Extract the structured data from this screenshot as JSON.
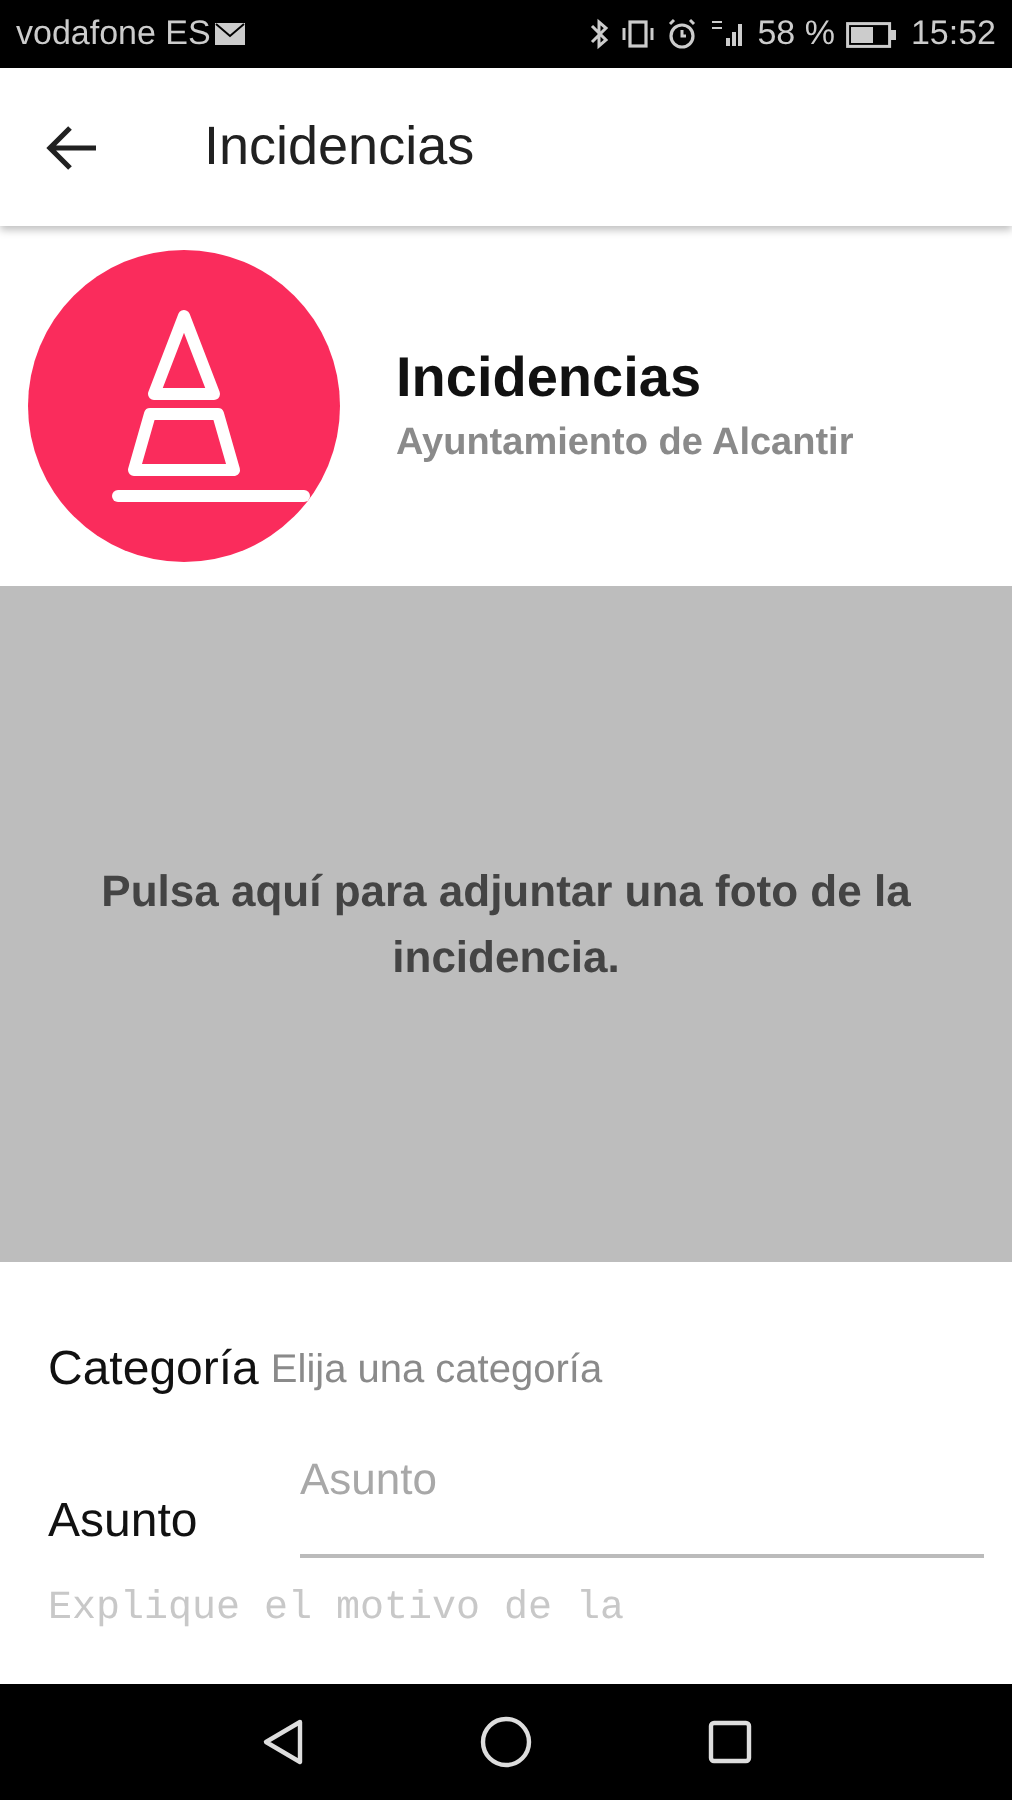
{
  "status_bar": {
    "carrier": "vodafone ES",
    "battery": "58 %",
    "time": "15:52"
  },
  "app_bar": {
    "title": "Incidencias"
  },
  "header": {
    "title": "Incidencias",
    "subtitle": "Ayuntamiento de Alcantir"
  },
  "photo": {
    "prompt": "Pulsa aquí para adjuntar una foto de la incidencia."
  },
  "form": {
    "category": {
      "label": "Categoría",
      "placeholder": "Elija una categoría"
    },
    "subject": {
      "label": "Asunto",
      "placeholder": "Asunto"
    },
    "description": {
      "placeholder": "Explique el motivo de la"
    }
  }
}
